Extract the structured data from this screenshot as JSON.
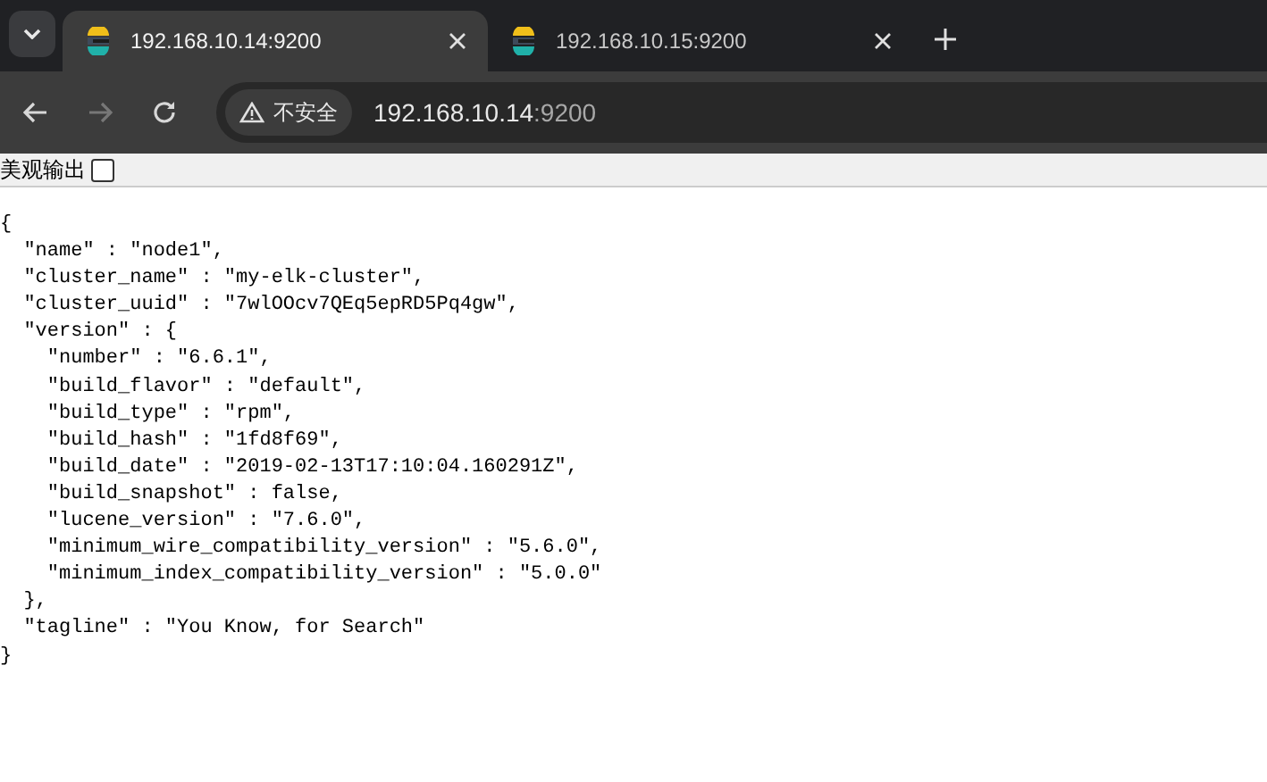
{
  "tabs": [
    {
      "title": "192.168.10.14:9200",
      "selected": true
    },
    {
      "title": "192.168.10.15:9200",
      "selected": false
    }
  ],
  "address_bar": {
    "security_label": "不安全",
    "host": "192.168.10.14",
    "port": ":9200"
  },
  "page": {
    "pretty_print": {
      "label": "美观输出",
      "checked": false
    },
    "body": "{\n  \"name\" : \"node1\",\n  \"cluster_name\" : \"my-elk-cluster\",\n  \"cluster_uuid\" : \"7wlOOcv7QEq5epRD5Pq4gw\",\n  \"version\" : {\n    \"number\" : \"6.6.1\",\n    \"build_flavor\" : \"default\",\n    \"build_type\" : \"rpm\",\n    \"build_hash\" : \"1fd8f69\",\n    \"build_date\" : \"2019-02-13T17:10:04.160291Z\",\n    \"build_snapshot\" : false,\n    \"lucene_version\" : \"7.6.0\",\n    \"minimum_wire_compatibility_version\" : \"5.6.0\",\n    \"minimum_index_compatibility_version\" : \"5.0.0\"\n  },\n  \"tagline\" : \"You Know, for Search\"\n}"
  }
}
